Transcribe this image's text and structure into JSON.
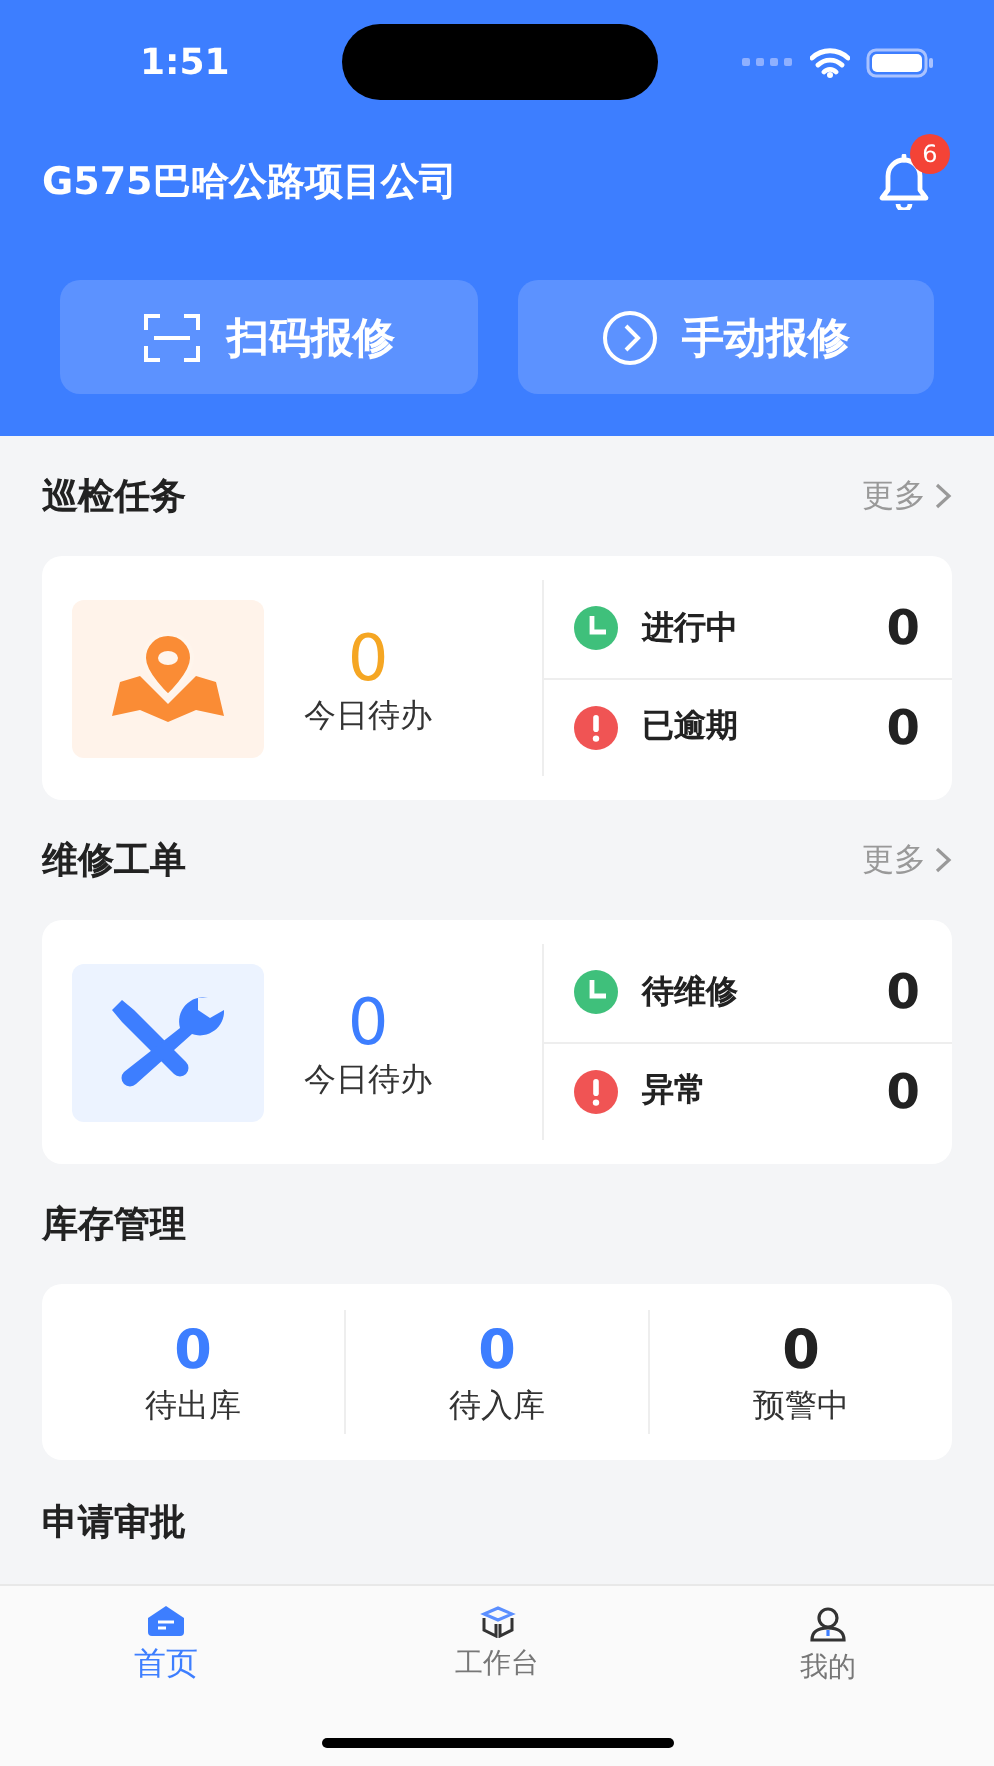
{
  "status_bar": {
    "time": "1:51"
  },
  "header": {
    "title": "G575巴哈公路项目公司",
    "notification_count": "6"
  },
  "actions": [
    {
      "kind": "scan",
      "label": "扫码报修"
    },
    {
      "kind": "manual",
      "label": "手动报修"
    }
  ],
  "sections": [
    {
      "title": "巡检任务",
      "more": "更多",
      "kind": "map",
      "today_count": "0",
      "today_label": "今日待办",
      "statuses": [
        {
          "kind": "progress",
          "label": "进行中",
          "count": "0"
        },
        {
          "kind": "overdue",
          "label": "已逾期",
          "count": "0"
        }
      ]
    },
    {
      "title": "维修工单",
      "more": "更多",
      "kind": "tools",
      "today_count": "0",
      "today_label": "今日待办",
      "statuses": [
        {
          "kind": "progress",
          "label": "待维修",
          "count": "0"
        },
        {
          "kind": "overdue",
          "label": "异常",
          "count": "0"
        }
      ]
    }
  ],
  "inventory": {
    "title": "库存管理",
    "items": [
      {
        "kind": "pending",
        "count": "0",
        "label": "待出库"
      },
      {
        "kind": "pending",
        "count": "0",
        "label": "待入库"
      },
      {
        "kind": "alert",
        "count": "0",
        "label": "预警中"
      }
    ]
  },
  "approval": {
    "title": "申请审批"
  },
  "tab_bar": [
    {
      "kind": "home",
      "label": "首页",
      "selected": true
    },
    {
      "kind": "workbench",
      "label": "工作台",
      "selected": false
    },
    {
      "kind": "profile",
      "label": "我的",
      "selected": false
    }
  ]
}
